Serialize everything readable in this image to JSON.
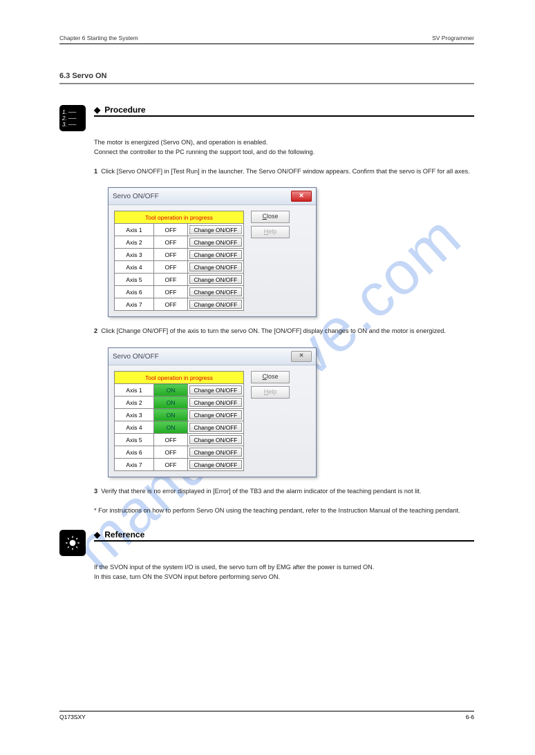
{
  "header": {
    "left": "Chapter 6  Starting the System",
    "right": "SV Programmer",
    "section_title": "6.3  Servo ON"
  },
  "procedure": {
    "title": "Procedure",
    "intro_line1": "The motor is energized (Servo ON), and operation is enabled.",
    "intro_line2": "Connect the controller to the PC running the support tool, and do the following.",
    "step1": {
      "num": "1",
      "text": "Click [Servo ON/OFF] in [Test Run] in the launcher. The Servo ON/OFF window appears. Confirm that the servo is OFF for all axes.",
      "dialog": {
        "title": "Servo ON/OFF",
        "warning": "Tool operation in progress",
        "close_label": "Close",
        "help_label": "Help",
        "change_label": "Change ON/OFF",
        "rows": [
          {
            "name": "Axis 1",
            "state": "OFF",
            "on": false
          },
          {
            "name": "Axis 2",
            "state": "OFF",
            "on": false
          },
          {
            "name": "Axis 3",
            "state": "OFF",
            "on": false
          },
          {
            "name": "Axis 4",
            "state": "OFF",
            "on": false
          },
          {
            "name": "Axis 5",
            "state": "OFF",
            "on": false
          },
          {
            "name": "Axis 6",
            "state": "OFF",
            "on": false
          },
          {
            "name": "Axis 7",
            "state": "OFF",
            "on": false
          }
        ]
      }
    },
    "step2": {
      "num": "2",
      "text": "Click [Change ON/OFF] of the axis to turn the servo ON. The [ON/OFF] display changes to ON and the motor is energized.",
      "dialog": {
        "title": "Servo ON/OFF",
        "warning": "Tool operation in progress",
        "close_label": "Close",
        "help_label": "Help",
        "change_label": "Change ON/OFF",
        "rows": [
          {
            "name": "Axis 1",
            "state": "ON",
            "on": true
          },
          {
            "name": "Axis 2",
            "state": "ON",
            "on": true
          },
          {
            "name": "Axis 3",
            "state": "ON",
            "on": true
          },
          {
            "name": "Axis 4",
            "state": "ON",
            "on": true
          },
          {
            "name": "Axis 5",
            "state": "OFF",
            "on": false
          },
          {
            "name": "Axis 6",
            "state": "OFF",
            "on": false
          },
          {
            "name": "Axis 7",
            "state": "OFF",
            "on": false
          }
        ]
      }
    },
    "step3": {
      "num": "3",
      "text": "Verify that there is no error displayed in [Error] of the TB3 and the alarm indicator of the teaching pendant is not lit.",
      "note": "* For instructions on how to perform Servo ON using the teaching pendant, refer to the Instruction Manual of the teaching pendant."
    }
  },
  "reference": {
    "title": "Reference",
    "line1": "If the SVON input of the system I/O is used, the servo turn off by EMG after the power is turned ON.",
    "line2": "In this case, turn ON the SVON input before performing servo ON."
  },
  "watermark": "manualshive.com",
  "footer": {
    "left": "Q173SXY",
    "right": "6-6"
  }
}
